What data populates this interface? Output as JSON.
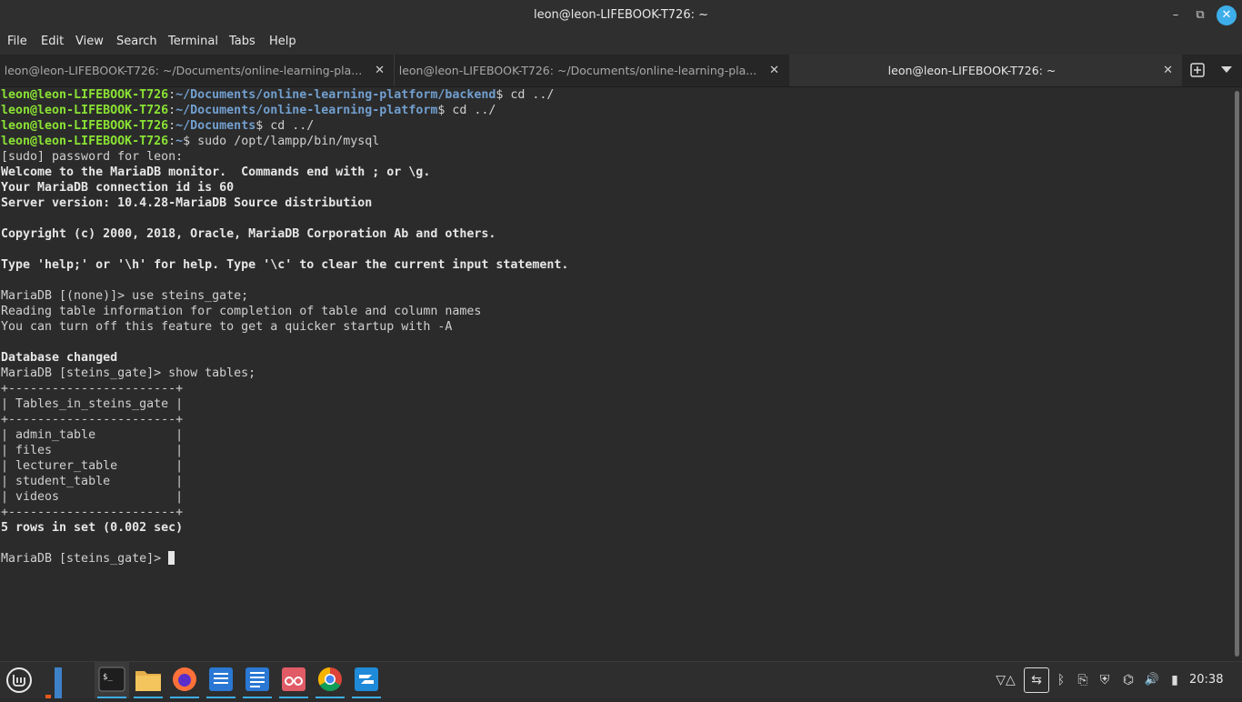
{
  "window": {
    "title": "leon@leon-LIFEBOOK-T726: ~",
    "controls": {
      "minimize": "–",
      "maximize": "⧉",
      "close": "✕"
    }
  },
  "menu": [
    "File",
    "Edit",
    "View",
    "Search",
    "Terminal",
    "Tabs",
    "Help"
  ],
  "tabs": [
    {
      "label": "leon@leon-LIFEBOOK-T726: ~/Documents/online-learning-pla...",
      "close": "✕",
      "active": false
    },
    {
      "label": "leon@leon-LIFEBOOK-T726: ~/Documents/online-learning-pla...",
      "close": "✕",
      "active": false
    },
    {
      "label": "leon@leon-LIFEBOOK-T726: ~",
      "close": "✕",
      "active": true
    }
  ],
  "terminal": {
    "l1": {
      "user": "leon@leon-LIFEBOOK-T726",
      "path": "~/Documents/online-learning-platform/backend",
      "cmd": "$ cd ../"
    },
    "l2": {
      "user": "leon@leon-LIFEBOOK-T726",
      "path": "~/Documents/online-learning-platform",
      "cmd": "$ cd ../"
    },
    "l3": {
      "user": "leon@leon-LIFEBOOK-T726",
      "path": "~/Documents",
      "cmd": "$ cd ../"
    },
    "l4": {
      "user": "leon@leon-LIFEBOOK-T726",
      "path": "~",
      "cmd": "$ sudo /opt/lampp/bin/mysql"
    },
    "l5": "[sudo] password for leon:",
    "l6": "Welcome to the MariaDB monitor.  Commands end with ; or \\g.",
    "l7": "Your MariaDB connection id is 60",
    "l8": "Server version: 10.4.28-MariaDB Source distribution",
    "l9": "",
    "l10": "Copyright (c) 2000, 2018, Oracle, MariaDB Corporation Ab and others.",
    "l11": "",
    "l12": "Type 'help;' or '\\h' for help. Type '\\c' to clear the current input statement.",
    "l13": "",
    "l14": "MariaDB [(none)]> use steins_gate;",
    "l15": "Reading table information for completion of table and column names",
    "l16": "You can turn off this feature to get a quicker startup with -A",
    "l17": "",
    "l18": "Database changed",
    "l19": "MariaDB [steins_gate]> show tables;",
    "l20": "+-----------------------+",
    "l21": "| Tables_in_steins_gate |",
    "l22": "+-----------------------+",
    "l23": "| admin_table           |",
    "l24": "| files                 |",
    "l25": "| lecturer_table        |",
    "l26": "| student_table         |",
    "l27": "| videos                |",
    "l28": "+-----------------------+",
    "l29": "5 rows in set (0.002 sec)",
    "l30": "",
    "l31": "MariaDB [steins_gate]> "
  },
  "taskbar": {
    "apps": [
      "menu-icon",
      "show-desktop-icon",
      "terminal-icon",
      "files-icon",
      "firefox-icon",
      "text-editor-icon",
      "writer-icon",
      "reader-icon",
      "chrome-icon",
      "anydesk-icon"
    ],
    "tray": [
      "▽△",
      "⇆",
      "ᛒ",
      "⎘",
      "⛨",
      "⌬",
      "🔊",
      "▮"
    ],
    "clock": "20:38"
  },
  "colors": {
    "accent": "#3daee9",
    "prompt_user": "#8ae234",
    "prompt_path": "#729fcf",
    "bg": "#2b2b2b"
  }
}
